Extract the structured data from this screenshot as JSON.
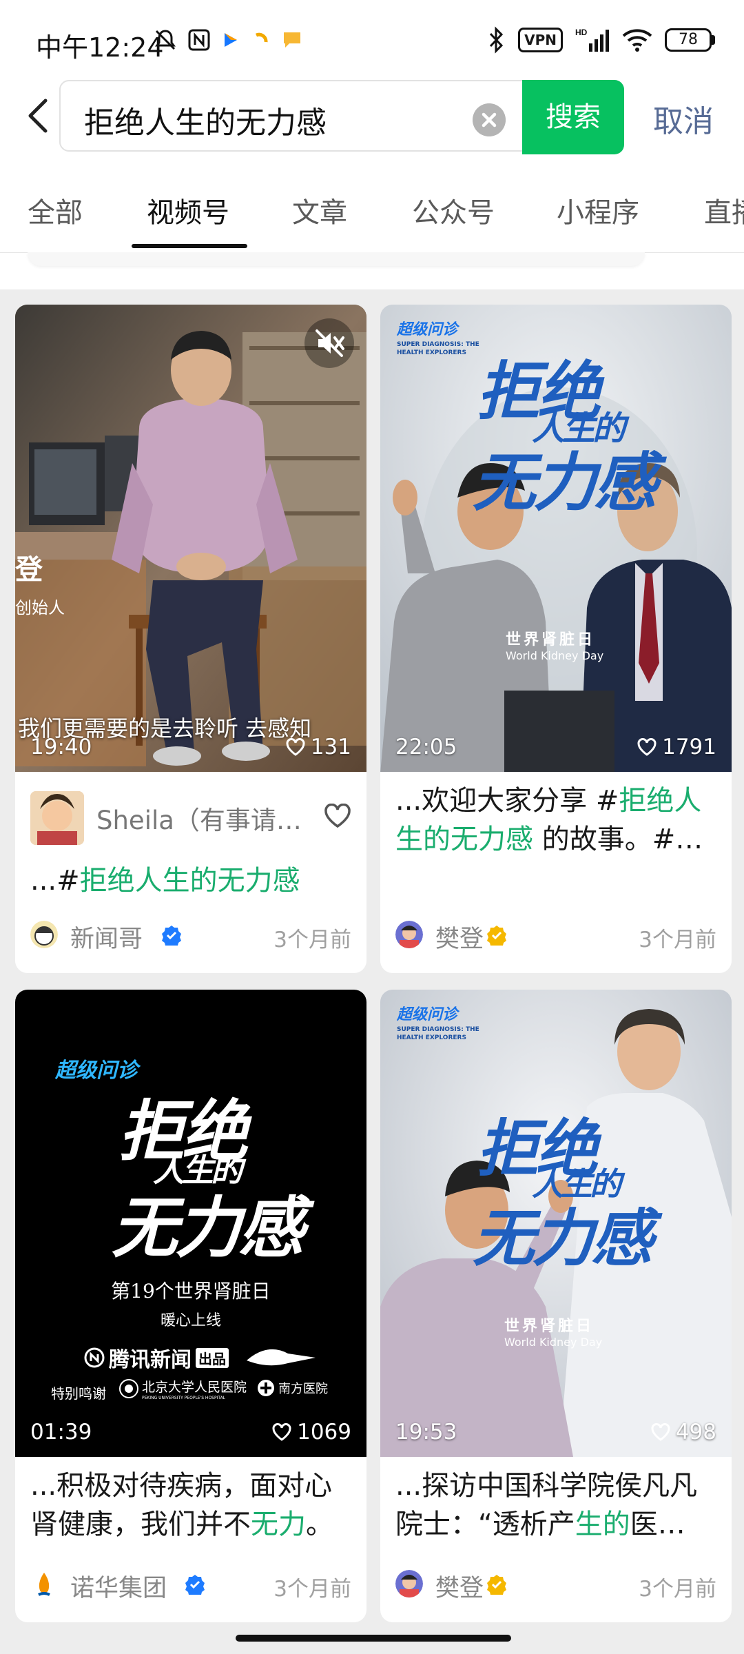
{
  "status_bar": {
    "time": "中午12:24",
    "vpn": "VPN",
    "battery": "78"
  },
  "search": {
    "query": "拒绝人生的无力感",
    "button": "搜索",
    "cancel": "取消"
  },
  "tabs": [
    {
      "label": "全部",
      "active": false
    },
    {
      "label": "视频号",
      "active": true
    },
    {
      "label": "文章",
      "active": false
    },
    {
      "label": "公众号",
      "active": false
    },
    {
      "label": "小程序",
      "active": false
    },
    {
      "label": "直播",
      "active": false
    }
  ],
  "cards": [
    {
      "duration": "19:40",
      "likes": "131",
      "thumb_caption": "我们更需要的是去聆听 去感知",
      "thumb_side_1": "登",
      "thumb_side_2": "创始人",
      "author_line": "Sheila（有事请…",
      "text_pre": "...#",
      "text_hl": "拒绝人生的无力感",
      "text_post": "",
      "account": "新闻哥",
      "badge_color": "#1e7bff",
      "time": "3个月前"
    },
    {
      "duration": "22:05",
      "likes": "1791",
      "thumb_logo": "超级问诊",
      "thumb_logo_sub": "SUPER DIAGNOSIS: THE HEALTH EXPLORERS",
      "thumb_title_1": "拒绝",
      "thumb_title_2": "人生的",
      "thumb_title_3": "无力感",
      "thumb_event": "世界肾脏日",
      "thumb_event_en": "World Kidney Day",
      "text_pre": "...欢迎大家分享 #",
      "text_hl": "拒绝人生的无力感",
      "text_post": " 的故事。#…",
      "account": "樊登",
      "badge_color": "#f5b800",
      "time": "3个月前"
    },
    {
      "duration": "01:39",
      "likes": "1069",
      "thumb_logo": "超级问诊",
      "thumb_title_1": "拒绝",
      "thumb_title_2": "人生的",
      "thumb_title_3": "无力感",
      "thumb_line_1": "第19个世界肾脏日",
      "thumb_line_2": "暖心上线",
      "thumb_brand": "腾讯新闻",
      "thumb_brand_tag": "出品",
      "thumb_thanks": "特别鸣谢",
      "thumb_hospital_1": "北京大学人民医院",
      "thumb_hospital_1_en": "PEKING UNIVERSITY PEOPLE'S HOSPITAL",
      "thumb_hospital_2": "南方医院",
      "text_pre": "...积极对待疾病，面对心肾健康，我们并不",
      "text_hl": "无力",
      "text_post": "。",
      "account": "诺华集团",
      "badge_color": "#1e7bff",
      "time": "3个月前"
    },
    {
      "duration": "19:53",
      "likes": "498",
      "thumb_logo": "超级问诊",
      "thumb_logo_sub": "SUPER DIAGNOSIS: THE HEALTH EXPLORERS",
      "thumb_title_1": "拒绝",
      "thumb_title_2": "人生的",
      "thumb_title_3": "无力感",
      "thumb_event": "世界肾脏日",
      "thumb_event_en": "World Kidney Day",
      "text_pre": "...探访中国科学院侯凡凡院士：“透析产",
      "text_hl": "生的",
      "text_post": "医…",
      "account": "樊登",
      "badge_color": "#f5b800",
      "time": "3个月前"
    }
  ]
}
